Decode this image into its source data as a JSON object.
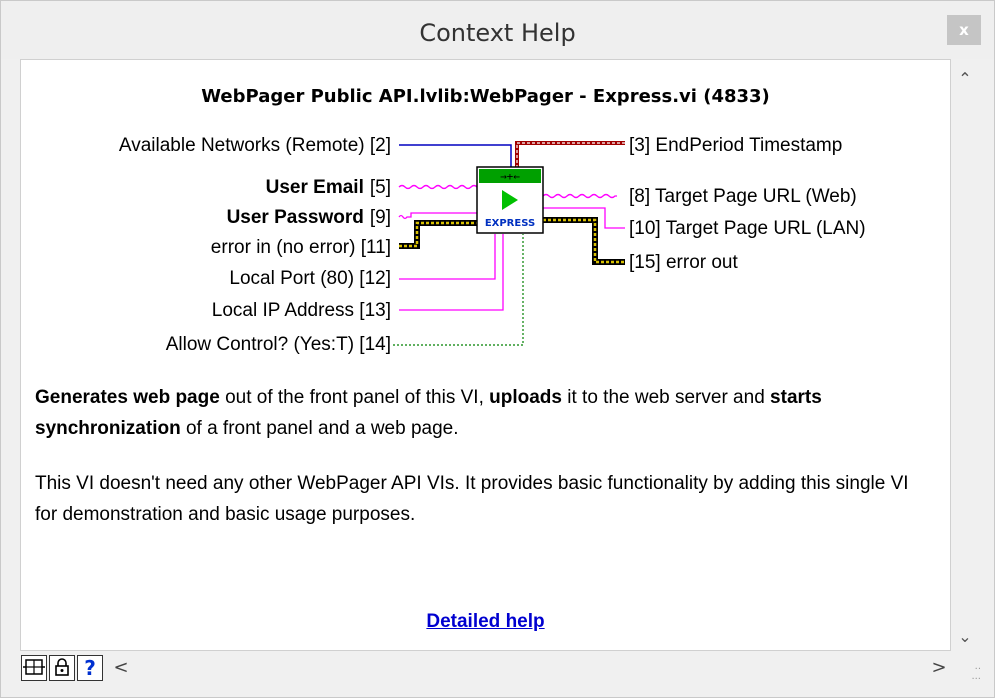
{
  "window": {
    "title": "Context Help",
    "close_label": "x"
  },
  "vi": {
    "title": "WebPager Public API.lvlib:WebPager - Express.vi (4833)",
    "icon_label": "EXPRESS",
    "inputs": [
      {
        "label": "Available Networks (Remote) [2]",
        "bold": false
      },
      {
        "label": "User Email",
        "num": "[5]",
        "bold": true
      },
      {
        "label": "User Password",
        "num": "[9]",
        "bold": true
      },
      {
        "label": "error in (no error) [11]",
        "bold": false
      },
      {
        "label": "Local Port (80) [12]",
        "bold": false
      },
      {
        "label": "Local IP Address [13]",
        "bold": false
      },
      {
        "label": "Allow Control? (Yes:T) [14]",
        "bold": false
      }
    ],
    "outputs": [
      {
        "label": "[3] EndPeriod Timestamp"
      },
      {
        "label": "[8] Target Page URL (Web)"
      },
      {
        "label": "[10] Target Page URL (LAN)"
      },
      {
        "label": "[15] error out"
      }
    ]
  },
  "description": {
    "p1": {
      "b1": "Generates web page",
      "t1": " out of the front panel of this VI, ",
      "b2": "uploads",
      "t2": " it to the web server and ",
      "b3": "starts synchronization",
      "t3": " of a front panel and a web page."
    },
    "p2": "This VI doesn't need any other WebPager API VIs. It provides basic functionality by adding this single VI for demonstration and basic usage purposes."
  },
  "link": {
    "detailed_help": "Detailed help"
  },
  "toolbar": {
    "help_label": "?"
  },
  "colors": {
    "link": "#0000d0",
    "pink_wire": "#ff00ff",
    "error_wire": "#c8b400",
    "timestamp_wire": "#a00000",
    "blue_wire": "#0000c0",
    "bool_wire": "#008000"
  }
}
